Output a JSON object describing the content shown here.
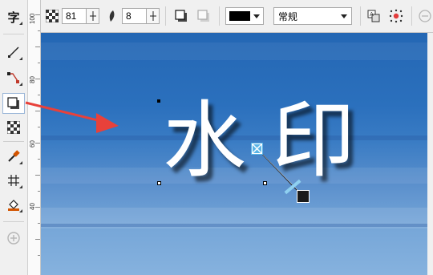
{
  "toolbox": {
    "tools": [
      {
        "name": "text-tool",
        "label": "字"
      },
      {
        "name": "line-tool"
      },
      {
        "name": "connector-tool"
      },
      {
        "name": "drop-shadow-tool"
      },
      {
        "name": "transparency-tool"
      },
      {
        "name": "eyedropper-tool"
      },
      {
        "name": "smart-fill-tool"
      },
      {
        "name": "fill-tool"
      },
      {
        "name": "add-tool"
      }
    ]
  },
  "ruler": {
    "labels": [
      "40",
      "60",
      "80",
      "100"
    ]
  },
  "propbar": {
    "opacity_value": "81",
    "feather_value": "8",
    "shadow_color": "#000000",
    "merge_mode": "常规"
  },
  "canvas": {
    "watermark_left": "水",
    "watermark_right": "印"
  },
  "colors": {
    "annotation_arrow": "#e8413a",
    "accent_handle": "#5ab4e6"
  }
}
